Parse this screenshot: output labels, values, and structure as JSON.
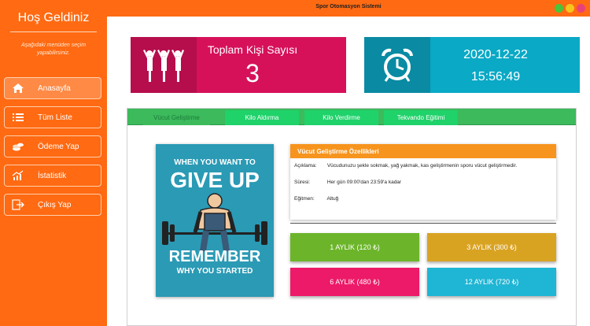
{
  "window": {
    "title": "Spor Otomasyon Sistemi"
  },
  "sidebar": {
    "title": "Hoş Geldiniz",
    "subtitle": "Aşağıdaki menüden seçim yapabilirsiniz.",
    "items": [
      {
        "label": "Anasayfa",
        "icon": "home-icon"
      },
      {
        "label": "Tüm Liste",
        "icon": "list-icon"
      },
      {
        "label": "Ödeme Yap",
        "icon": "coins-icon"
      },
      {
        "label": "İstatistik",
        "icon": "chart-icon"
      },
      {
        "label": "Çıkış Yap",
        "icon": "exit-icon"
      }
    ]
  },
  "stats": {
    "people_label": "Toplam Kişi Sayısı",
    "people_count": "3",
    "date": "2020-12-22",
    "time": "15:56:49"
  },
  "tabs": [
    "Vücut Geliştirme",
    "Kilo Aldırma",
    "Kilo Verdirme",
    "Tekvando Eğitimi"
  ],
  "poster": {
    "line1": "WHEN YOU WANT TO",
    "line2": "GIVE UP",
    "line3": "REMEMBER",
    "line4": "WHY YOU STARTED"
  },
  "details": {
    "title": "Vücut Geliştirme Özellikleri",
    "desc_key": "Açıklama:",
    "desc_val": "Vücudunuzu şekle sokmak, yağ yakmak, kas geliştirmenin sporu vücut geliştirmedir.",
    "duration_key": "Süresi:",
    "duration_val": "Her gün 09:00'dan 23:59'a kadar",
    "trainer_key": "Eğitmen:",
    "trainer_val": "Altuğ"
  },
  "plans": [
    {
      "label": "1 AYLIK (120 ₺)",
      "color": "#6cb52a"
    },
    {
      "label": "3 AYLIK (300 ₺)",
      "color": "#d9a322"
    },
    {
      "label": "6 AYLIK (480 ₺)",
      "color": "#ec1a68"
    },
    {
      "label": "12 AYLIK (720 ₺)",
      "color": "#1fb5d4"
    }
  ],
  "colors": {
    "accent": "#ff6a12",
    "people_card": "#d6115a",
    "time_card": "#0aa9c6",
    "tabbar": "#3cba5c"
  }
}
